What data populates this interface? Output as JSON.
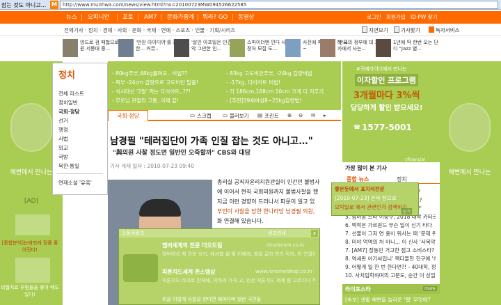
{
  "browser": {
    "title": "잡는 것도 아니고...",
    "favicon": "M",
    "url": "http://www.munhwa.com/news/view.html?no=20100723MW094526622585"
  },
  "topnav": {
    "items": [
      "뉴스",
      "오피니언",
      "포토",
      "AM7",
      "문화가중계",
      "뭐라? GO",
      "동영상"
    ],
    "right": [
      "로그인",
      "회원가입",
      "ID·PW 찾기"
    ]
  },
  "subnav": {
    "categories": "전체기사 · 정치 · 경제 · 사회 · 문화 · 국제 · 연예 · 스포츠 · 인물 · 기획/시리즈",
    "links": [
      "지면보기",
      "기사찾기",
      "독자서비스"
    ]
  },
  "thumbs": [
    "양드로 검 페협으로 만원 서롱대 중...",
    "'만원 아이디어'를 잡아한... 커뮤..",
    "'살인 아프일은 인간의 악 그만한 인...",
    "스파이더맨 인다 사건의 정처 모집 도...",
    "사진에 피서지서 하 요~",
    "'한국의 정부에 대 프리카에서 사는...",
    "1년에 딱 한번 오는 단디 \"Jazz 별..."
  ],
  "left_sidebar": {
    "section": "정치",
    "links": [
      "전체 리스트",
      "정치일반",
      "국회·정당",
      "선거",
      "행정",
      "사법",
      "외교",
      "국방",
      "북한·통일",
      "연재소설 '유혹'"
    ]
  },
  "left_ad": {
    "slogan": "해변에서 만나는",
    "ad_label": "[AD]",
    "promo1": "[종합분석]눈에띄게 정품 좋아진다!",
    "promo2": "비협치료 부럼들을 좋아 배도있다!"
  },
  "right_ad_side": {
    "slogan": "해변에서 만나는"
  },
  "green_ads": [
    [
      "- 80kg주부,48kg롤며오.. 비법??",
      "- 83kg 고도비만주부, -24kg 감량비법"
    ],
    [
      "- 복부 -24cm 감량으로 고도비만 탈출!",
      "- -17kg, 다이어트 비법!"
    ],
    [
      "- 식사대신 '2알' 먹는 다이어트,,??!",
      "- 키 186cm,168cm 10cm 크게 더 키우기"
    ],
    [
      "- 무모님 관절의 고통, 이제 끝!",
      "- [추천]39세여성8~25kg감량법!"
    ]
  ],
  "article_tabs": {
    "section_tab": "국회·정당",
    "tools": [
      "스크랩",
      "블러보기",
      "프린트"
    ]
  },
  "article": {
    "headline": "남경필 \"테러집단이 가족 인질 잡는 것도 아니고…\"",
    "subhead": "\"與의원 사찰 정도면 일반인 오죽할까\" CBS와 대담",
    "dateline": "기사 게재 일자 : 2010-07-23 09:40",
    "body": [
      "총리실 공직자윤리지원관실이 민간인 불법사",
      "에 이어서 현직 국회의원까지 불법사찰을 했",
      "지금 이런 경향이 드러나서 파문이 일고 있",
      "부인이 사찰을 당한 한나라당 남경필 의원,",
      "화 연결해 있습니다."
    ]
  },
  "popup": {
    "header": "스폰서링크",
    "close": "x",
    "right_head": "광고안내",
    "items": [
      {
        "title": "멤버세계의 전문 더오드림",
        "url": "deodream.co.kr",
        "desc": "멤버여성 제 전문 보기, 에서할 셀 몇 이에게, 범일 글자 한기 적의, 한 연결이 인수공, 연결!"
      },
      {
        "title": "피톤치드세계 존스멤삽",
        "url": "www.ionsmelshop.co.kr",
        "desc": "피톤치드 라이로 잔체에, 이하의 가격 고, 민상 피톤치드 세계 중 고르가나 직접 구판!"
      }
    ],
    "footer": "위을 이렇게 사찰을 한다면 해야다며 일반 국민들"
  },
  "right_panel": {
    "ad_top": "#귀에라이더에서 만나는",
    "ad_title": "이자할인 프로그램",
    "ad_rate": "3개월마다 3%씩",
    "ad_sub": "당당하게 할인 받으세요!",
    "ad_phone": "1577-5001",
    "ad_brand": "cfinancial",
    "most_read": "가장 많이 본 기사",
    "tabs": [
      "종합 뉴스",
      "정치"
    ],
    "list": [
      "2. 국민들의 경우들해지는 이유는?",
      "3. 남극의 최대 코끼리의 기대감은?",
      "4. 미국은 이었다가 '봉, 신경미국?'",
      "5. 남아공 스타 이중구, 2018 대박 카타르행",
      "6. 백학은 가르원드 무슨 일이 신기 타다",
      "7. 선물이 그저 연 용이 위사는 때 '문제 위약?",
      "8. 미야 억역의 처 아니... 이 신사 '사목악 사기꾼?",
      "7. [AM7] 장동민 거고한 점고 소비스타? 2...",
      "8. 역세판 아기씨입니' 팩다들한 친구에 '하...",
      "9. 어떻게 일 한 번 한다면?! - 40대학, 정에,",
      "10. 사치입학하며의 고문도, 순간 이 상일에 지?"
    ],
    "life_label": "라이프스타",
    "life_more": "more",
    "life_item": "[속보] 생활 해변을 놀라운 '웹' 무엇에?"
  },
  "tooltip": {
    "lines": [
      "좋은듯에서 표지석전문",
      "[2010-07-23] 온라 탐으로",
      "오탁일로 에서 관련인가 검색하기"
    ],
    "button": "닫기"
  }
}
